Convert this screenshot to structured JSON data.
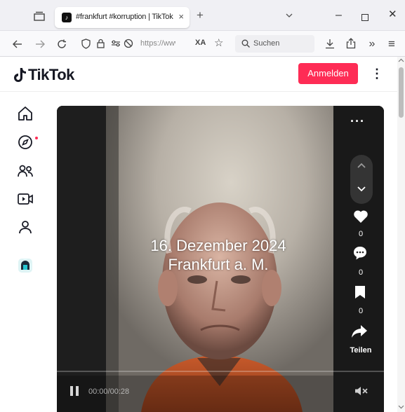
{
  "browser": {
    "tab": {
      "title": "#frankfurt #korruption | TikTok",
      "favicon": "tiktok-icon"
    },
    "new_tab": "+",
    "close_tab": "×",
    "window": {
      "minimize": "–",
      "close": "✕"
    },
    "address": {
      "url": "https://www.ti",
      "translate": "XA"
    },
    "search": {
      "placeholder": "Suchen"
    },
    "overflow": "»",
    "menu": "≡"
  },
  "tiktok": {
    "logo": "TikTok",
    "login_button": "Anmelden",
    "more": "⋮",
    "sidebar": [
      "home-icon",
      "explore-icon",
      "following-icon",
      "live-icon",
      "profile-icon",
      "app-icon"
    ]
  },
  "video": {
    "overlay_line1": "16. Dezember 2024",
    "overlay_line2": "Frankfurt a. M.",
    "more": "···",
    "likes": "0",
    "comments": "0",
    "saves": "0",
    "share_label": "Teilen",
    "time": "00:00/00:28",
    "progress": 0
  },
  "colors": {
    "accent": "#fe2c55",
    "text": "#161823"
  }
}
